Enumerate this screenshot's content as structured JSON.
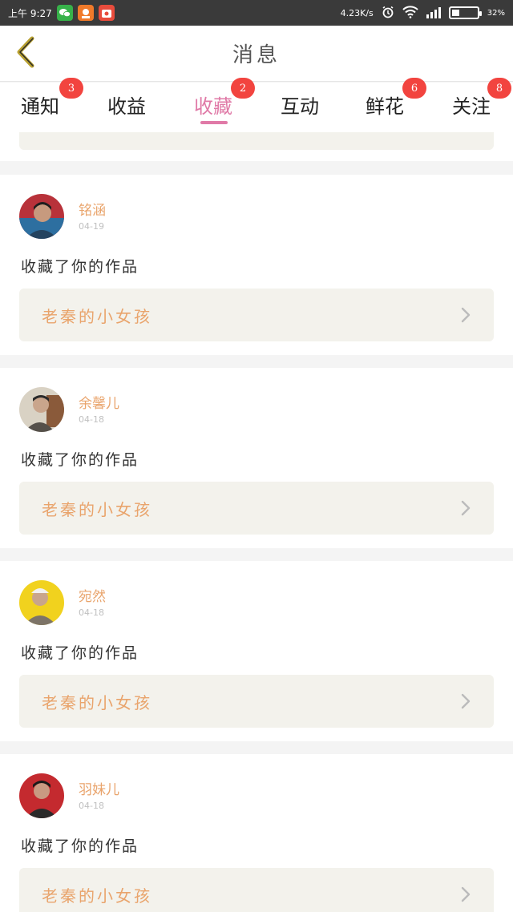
{
  "status_bar": {
    "time": "上午 9:27",
    "net_speed": "4.23K/s",
    "battery": "32%",
    "battery_level": 0.32,
    "app_icons": [
      "wechat-icon",
      "app-orange-icon",
      "app-red-icon"
    ]
  },
  "header": {
    "title": "消息",
    "back_icon": "chevron-left-icon"
  },
  "tabs": [
    {
      "label": "通知",
      "badge": "3",
      "active": false
    },
    {
      "label": "收益",
      "badge": "",
      "active": false
    },
    {
      "label": "收藏",
      "badge": "2",
      "active": true
    },
    {
      "label": "互动",
      "badge": "",
      "active": false
    },
    {
      "label": "鲜花",
      "badge": "6",
      "active": false
    },
    {
      "label": "关注",
      "badge": "8",
      "active": false
    }
  ],
  "items": [
    {
      "name": "铭涵",
      "date": "04-19",
      "action": "收藏了你的作品",
      "work": "老秦的小女孩"
    },
    {
      "name": "余馨儿",
      "date": "04-18",
      "action": "收藏了你的作品",
      "work": "老秦的小女孩"
    },
    {
      "name": "宛然",
      "date": "04-18",
      "action": "收藏了你的作品",
      "work": "老秦的小女孩"
    },
    {
      "name": "羽妹儿",
      "date": "04-18",
      "action": "收藏了你的作品",
      "work": "老秦的小女孩"
    }
  ],
  "colors": {
    "accent": "#e07aa7",
    "name": "#e9a46c",
    "badge": "#f2443f",
    "link_bg": "#f3f2ec",
    "back_arrow": "#b8a030"
  }
}
